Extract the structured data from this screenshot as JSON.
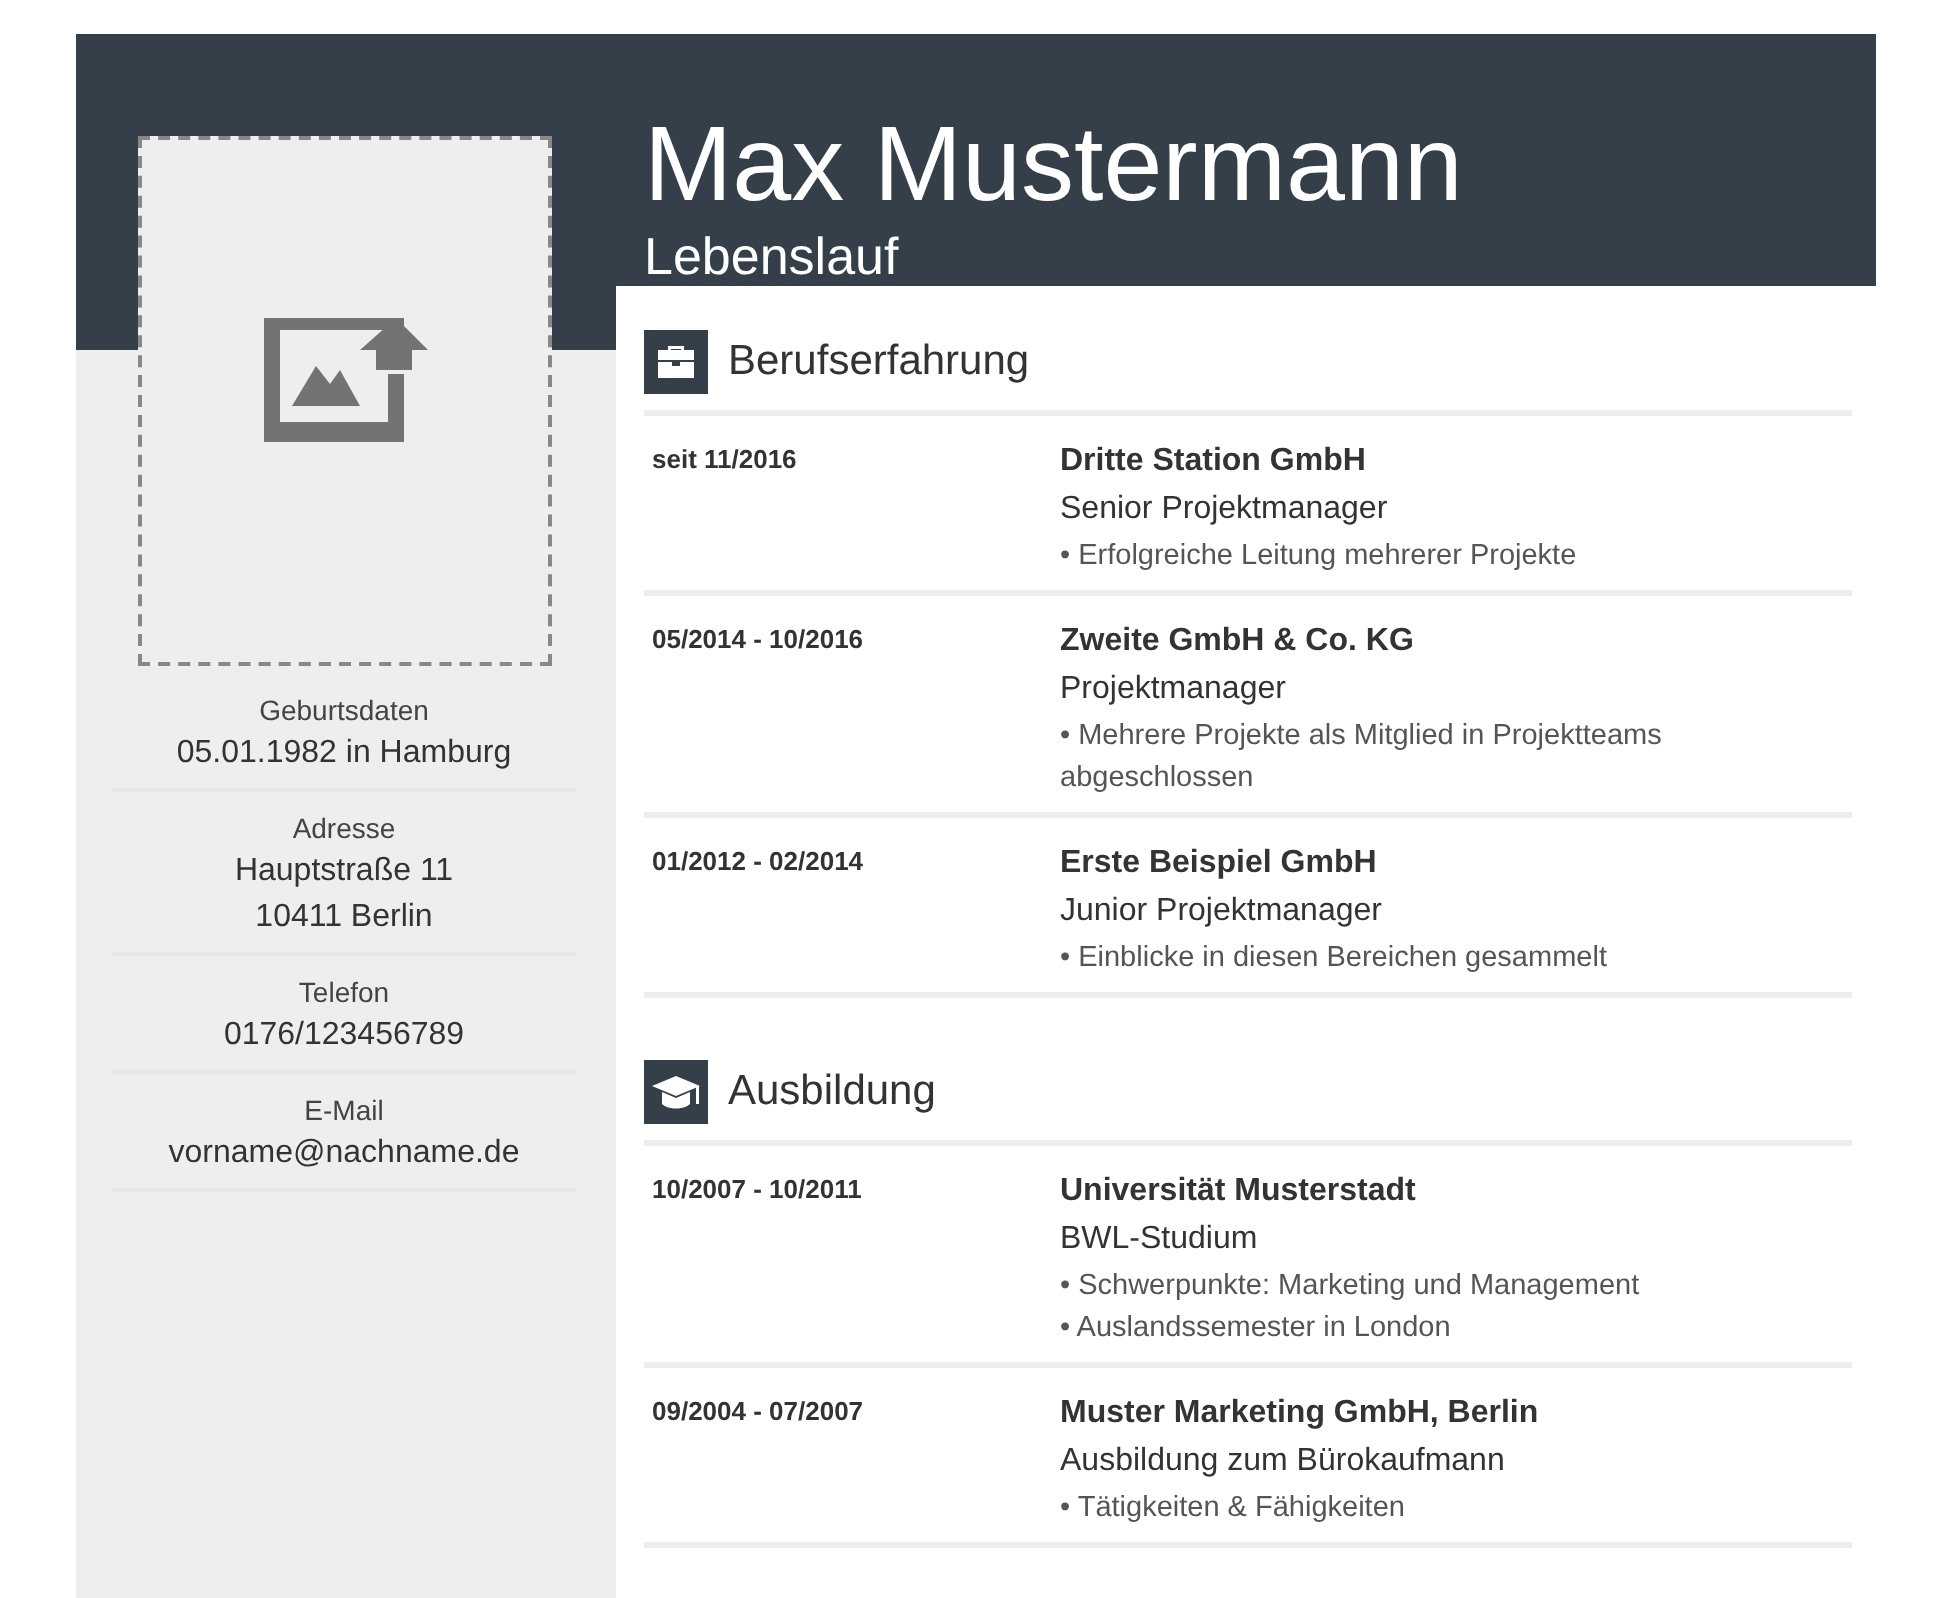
{
  "header": {
    "name": "Max Mustermann",
    "subtitle": "Lebenslauf"
  },
  "sidebar": {
    "photo": {
      "kind": "placeholder"
    },
    "details": [
      {
        "label": "Geburtsdaten",
        "lines": [
          "05.01.1982 in Hamburg"
        ]
      },
      {
        "label": "Adresse",
        "lines": [
          "Hauptstraße 11",
          "10411 Berlin"
        ]
      },
      {
        "label": "Telefon",
        "lines": [
          "0176/123456789"
        ]
      },
      {
        "label": "E-Mail",
        "lines": [
          "vorname@nachname.de"
        ]
      }
    ]
  },
  "sections": [
    {
      "title": "Berufserfahrung",
      "kind": "briefcase",
      "entries": [
        {
          "period": "seit 11/2016",
          "org": "Dritte Station GmbH",
          "role": "Senior Projektmanager",
          "bullets": [
            "• Erfolgreiche Leitung mehrerer Projekte"
          ]
        },
        {
          "period": "05/2014 - 10/2016",
          "org": "Zweite GmbH & Co. KG",
          "role": "Projektmanager",
          "bullets": [
            "• Mehrere Projekte als Mitglied in Projektteams abgeschlossen"
          ]
        },
        {
          "period": "01/2012 - 02/2014",
          "org": "Erste Beispiel GmbH",
          "role": "Junior Projektmanager",
          "bullets": [
            "• Einblicke in diesen Bereichen gesammelt"
          ]
        }
      ]
    },
    {
      "title": "Ausbildung",
      "kind": "graduation",
      "entries": [
        {
          "period": "10/2007 - 10/2011",
          "org": "Universität Musterstadt",
          "role": "BWL-Studium",
          "bullets": [
            "• Schwerpunkte: Marketing und Management",
            "• Auslandssemester in London"
          ]
        },
        {
          "period": "09/2004 - 07/2007",
          "org": "Muster Marketing GmbH, Berlin",
          "role": "Ausbildung zum Bürokaufmann",
          "bullets": [
            "• Tätigkeiten & Fähigkeiten"
          ]
        }
      ]
    }
  ]
}
